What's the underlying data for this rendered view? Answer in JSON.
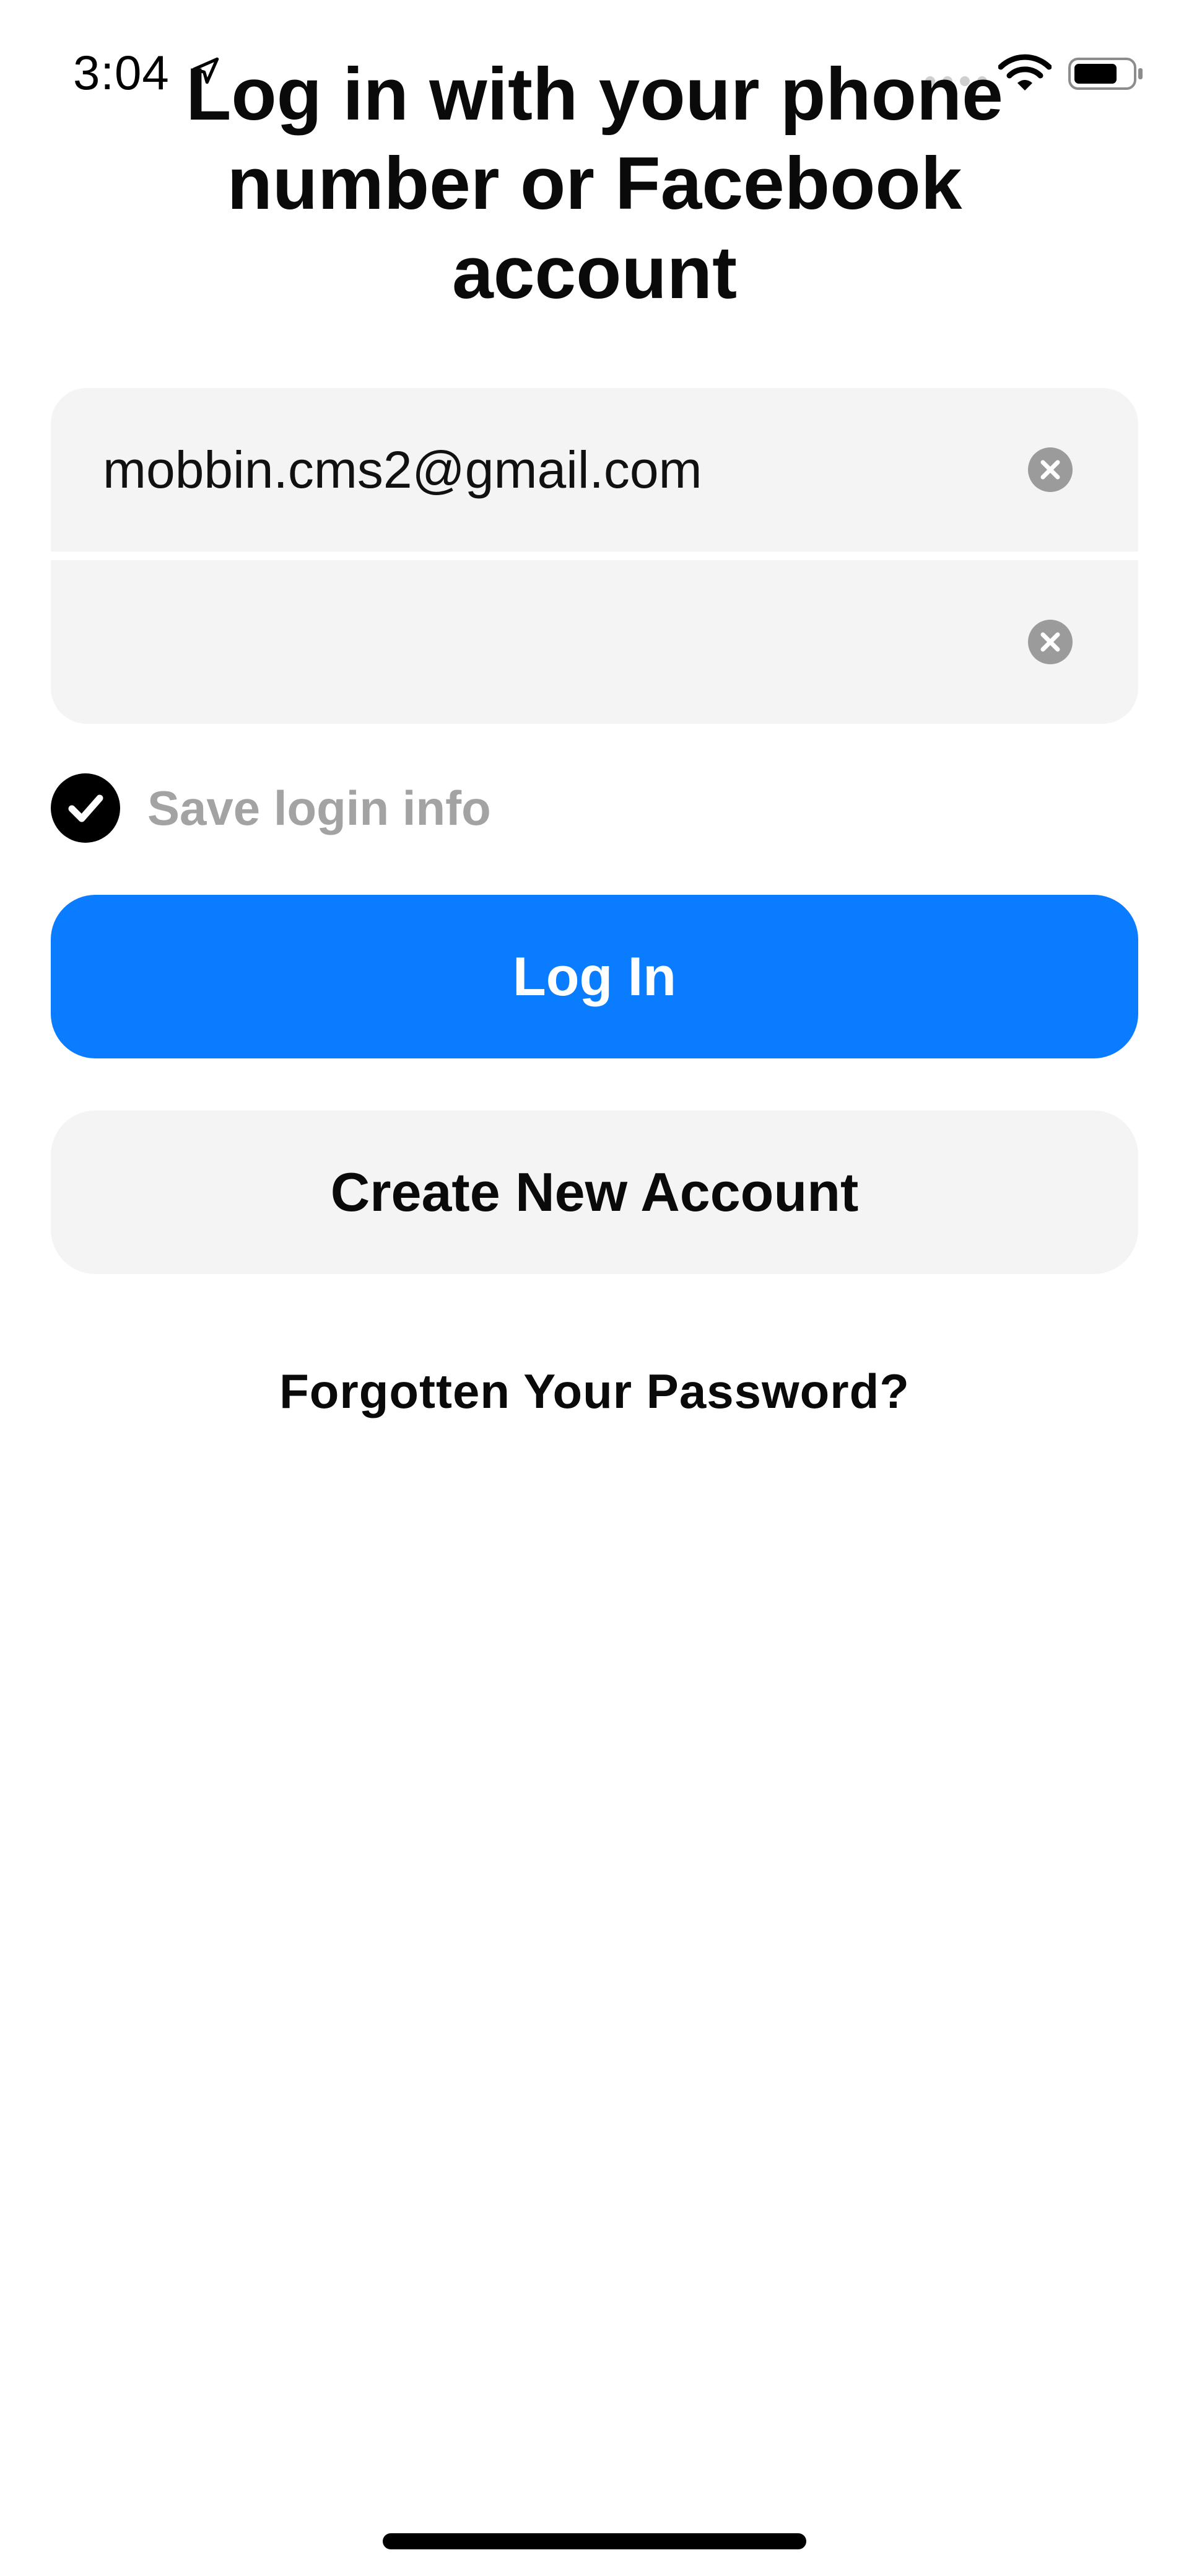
{
  "status_bar": {
    "time": "3:04",
    "icons": [
      "location-arrow-icon",
      "cellular-signal-icon",
      "wifi-icon",
      "battery-icon"
    ]
  },
  "title": "Log in with your phone number or Facebook account",
  "form": {
    "email_value": "mobbin.cms2@gmail.com",
    "password_value": "",
    "clear_icon": "clear-circle-icon"
  },
  "save_login": {
    "label": "Save login info",
    "checked": true
  },
  "buttons": {
    "login": "Log In",
    "create_account": "Create New Account",
    "forgot_password": "Forgotten Your Password?"
  },
  "colors": {
    "primary": "#0a7cff",
    "field_background": "#f4f4f4",
    "muted_text": "#a3a3a3"
  }
}
